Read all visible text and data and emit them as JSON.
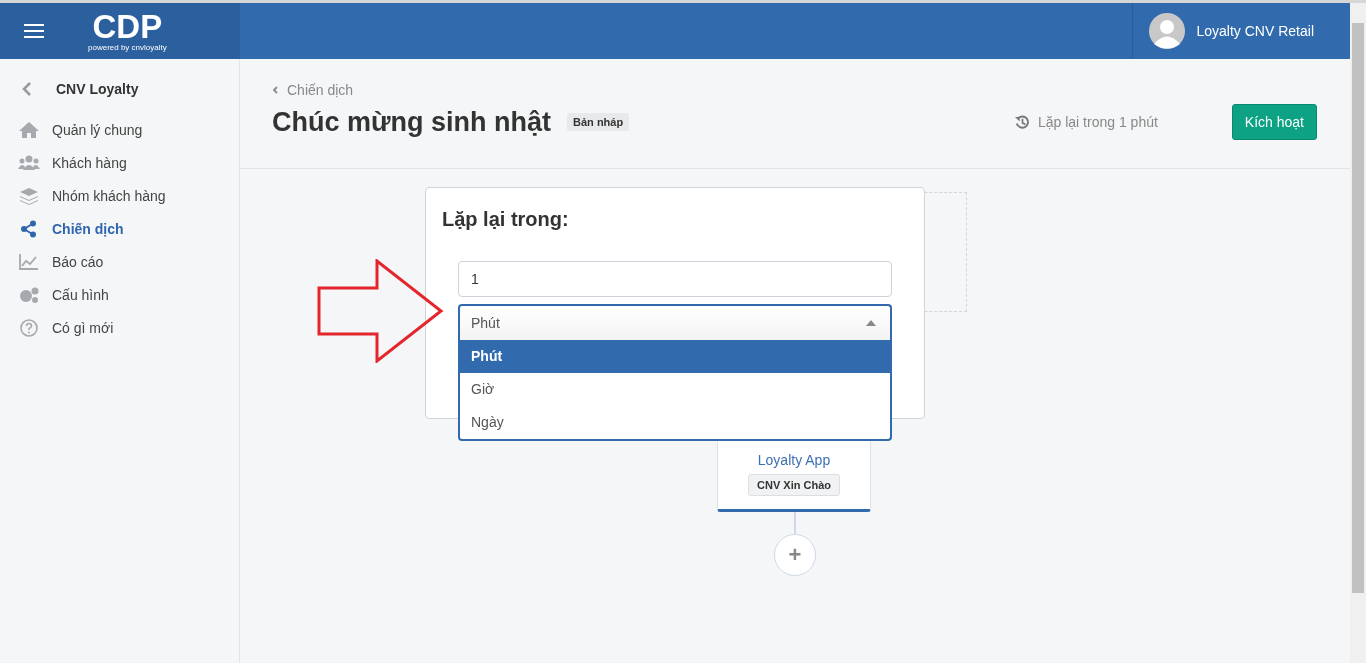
{
  "topbar": {
    "logo": "CDP",
    "logo_tagline": "powered by cnvloyalty",
    "user_name": "Loyalty CNV Retail"
  },
  "sidebar": {
    "back_title": "CNV Loyalty",
    "items": [
      {
        "label": "Quản lý chung",
        "selected": false
      },
      {
        "label": "Khách hàng",
        "selected": false
      },
      {
        "label": "Nhóm khách hàng",
        "selected": false
      },
      {
        "label": "Chiến dịch",
        "selected": true
      },
      {
        "label": "Báo cáo",
        "selected": false
      },
      {
        "label": "Cấu hình",
        "selected": false
      },
      {
        "label": "Có gì mới",
        "selected": false
      }
    ]
  },
  "page": {
    "breadcrumb": "Chiến dịch",
    "title": "Chúc mừng sinh nhật",
    "status_badge": "Bản nháp",
    "repeat_info": "Lặp lại trong 1 phút",
    "activate_button": "Kích hoạt"
  },
  "repeat_popup": {
    "title": "Lặp lại trong:",
    "value": "1",
    "unit_select": {
      "value": "Phút",
      "expanded": true,
      "options": [
        {
          "label": "Phút",
          "selected": true
        },
        {
          "label": "Giờ",
          "selected": false
        },
        {
          "label": "Ngày",
          "selected": false
        }
      ]
    }
  },
  "flow_node": {
    "channel": "Loyalty App",
    "message_tag": "CNV Xin Chào",
    "add_button": "+"
  }
}
